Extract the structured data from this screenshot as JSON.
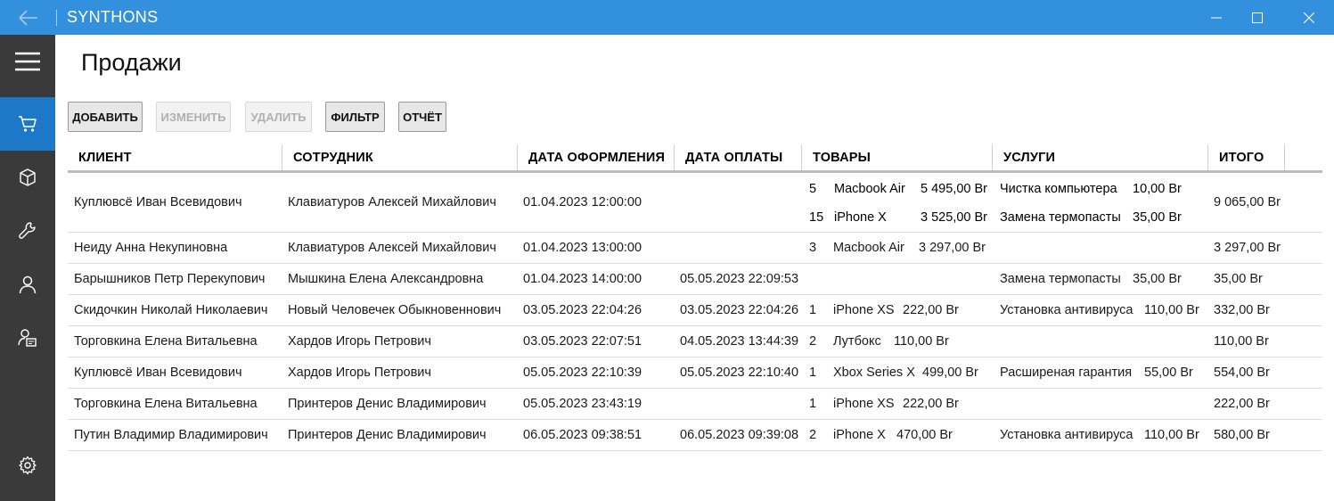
{
  "app": {
    "title": "SYNTHONS",
    "colors": {
      "titlebar": "#3390dd",
      "sidebar": "#3a3a3a",
      "active_nav": "#1e78c8"
    }
  },
  "sidebar": {
    "items": [
      {
        "icon": "hamburger-menu-icon"
      },
      {
        "icon": "cart-icon",
        "active": true
      },
      {
        "icon": "box-icon"
      },
      {
        "icon": "wrench-icon"
      },
      {
        "icon": "user-icon"
      },
      {
        "icon": "user-badge-icon"
      },
      {
        "icon": "gear-icon"
      }
    ]
  },
  "page": {
    "title": "Продажи"
  },
  "toolbar": {
    "add": "ДОБАВИТЬ",
    "edit": "ИЗМЕНИТЬ",
    "delete": "УДАЛИТЬ",
    "filter": "ФИЛЬТР",
    "report": "ОТЧЁТ"
  },
  "table": {
    "columns": [
      "КЛИЕНТ",
      "СОТРУДНИК",
      "ДАТА ОФОРМЛЕНИЯ",
      "ДАТА ОПЛАТЫ",
      "ТОВАРЫ",
      "УСЛУГИ",
      "ИТОГО"
    ],
    "rows": [
      {
        "client": "Куплювсё Иван Всевидович",
        "employee": "Клавиатуров Алексей Михайлович",
        "created": "01.04.2023 12:00:00",
        "paid": "",
        "goods": [
          {
            "qty": "5",
            "name": "Macbook Air",
            "price": "5 495,00 Br"
          },
          {
            "qty": "15",
            "name": "iPhone X",
            "price": "3 525,00 Br"
          }
        ],
        "services": [
          {
            "name": "Чистка компьютера",
            "price": "10,00 Br"
          },
          {
            "name": "Замена термопасты",
            "price": "35,00 Br"
          }
        ],
        "total": "9 065,00 Br"
      },
      {
        "client": "Неиду Анна Некупиновна",
        "employee": "Клавиатуров Алексей Михайлович",
        "created": "01.04.2023 13:00:00",
        "paid": "",
        "goods": [
          {
            "qty": "3",
            "name": "Macbook Air",
            "price": "3 297,00 Br"
          }
        ],
        "services": [],
        "total": "3 297,00 Br"
      },
      {
        "client": "Барышников Петр Перекупович",
        "employee": "Мышкина Елена Александровна",
        "created": "01.04.2023 14:00:00",
        "paid": "05.05.2023 22:09:53",
        "goods": [],
        "services": [
          {
            "name": "Замена термопасты",
            "price": "35,00 Br"
          }
        ],
        "total": "35,00 Br"
      },
      {
        "client": "Скидочкин Николай Николаевич",
        "employee": "Новый Человечек Обыкновеннович",
        "created": "03.05.2023 22:04:26",
        "paid": "03.05.2023 22:04:26",
        "goods": [
          {
            "qty": "1",
            "name": "iPhone XS",
            "price": "222,00 Br"
          }
        ],
        "services": [
          {
            "name": "Установка антивируса",
            "price": "110,00 Br"
          }
        ],
        "total": "332,00 Br"
      },
      {
        "client": "Торговкина Елена Витальевна",
        "employee": "Хардов Игорь Петрович",
        "created": "03.05.2023 22:07:51",
        "paid": "04.05.2023 13:44:39",
        "goods": [
          {
            "qty": "2",
            "name": "Лутбокс",
            "price": "110,00 Br"
          }
        ],
        "services": [],
        "total": "110,00 Br"
      },
      {
        "client": "Куплювсё Иван Всевидович",
        "employee": "Хардов Игорь Петрович",
        "created": "05.05.2023 22:10:39",
        "paid": "05.05.2023 22:10:40",
        "goods": [
          {
            "qty": "1",
            "name": "Xbox Series X",
            "price": "499,00 Br"
          }
        ],
        "services": [
          {
            "name": "Расширеная гарантия",
            "price": "55,00 Br"
          }
        ],
        "total": "554,00 Br"
      },
      {
        "client": "Торговкина Елена Витальевна",
        "employee": "Принтеров Денис Владимирович",
        "created": "05.05.2023 23:43:19",
        "paid": "",
        "goods": [
          {
            "qty": "1",
            "name": "iPhone XS",
            "price": "222,00 Br"
          }
        ],
        "services": [],
        "total": "222,00 Br"
      },
      {
        "client": "Путин Владимир Владимирович",
        "employee": "Принтеров Денис Владимирович",
        "created": "06.05.2023 09:38:51",
        "paid": "06.05.2023 09:39:08",
        "goods": [
          {
            "qty": "2",
            "name": "iPhone X",
            "price": "470,00 Br"
          }
        ],
        "services": [
          {
            "name": "Установка антивируса",
            "price": "110,00 Br"
          }
        ],
        "total": "580,00 Br"
      }
    ]
  }
}
